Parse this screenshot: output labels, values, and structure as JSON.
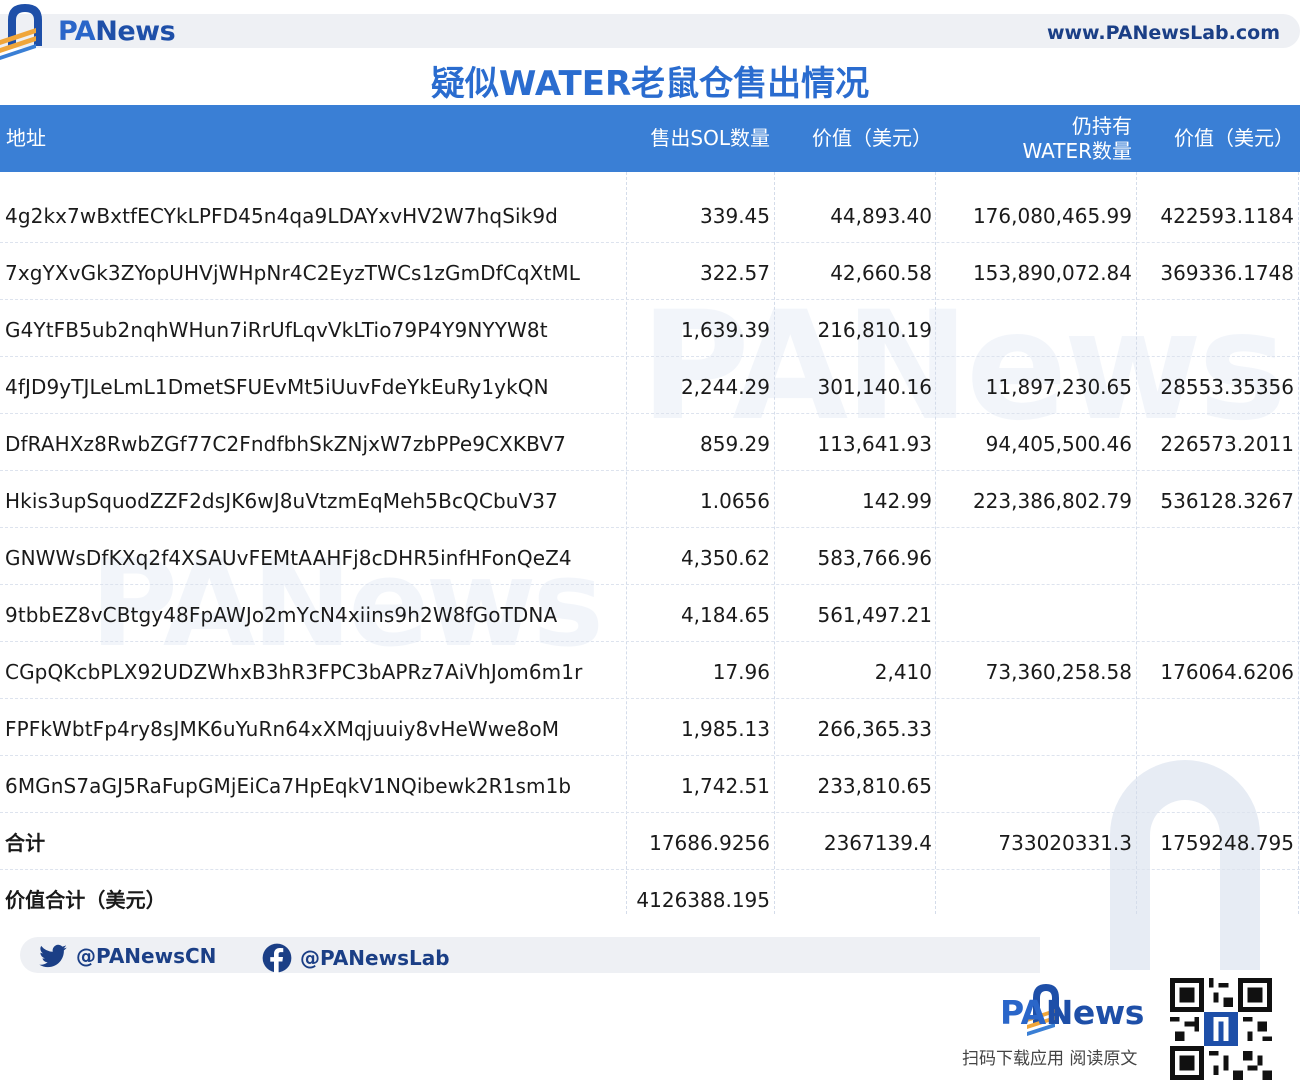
{
  "brand": {
    "logo_pa": "PA",
    "logo_news": "News",
    "url": "www.PANewsLab.com"
  },
  "title": "疑似WATER老鼠仓售出情况",
  "table": {
    "headers": {
      "address": "地址",
      "sol_sold": "售出SOL数量",
      "usd_value": "价值（美元）",
      "water_held_1": "仍持有",
      "water_held_2": "WATER数量",
      "water_value": "价值（美元）"
    },
    "rows": [
      {
        "address": "4g2kx7wBxtfECYkLPFD45n4qa9LDAYxvHV2W7hqSik9d",
        "sol": "339.45",
        "usd": "44,893.40",
        "water": "176,080,465.99",
        "value": "422593.1184"
      },
      {
        "address": "7xgYXvGk3ZYopUHVjWHpNr4C2EyzTWCs1zGmDfCqXtML",
        "sol": "322.57",
        "usd": "42,660.58",
        "water": "153,890,072.84",
        "value": "369336.1748"
      },
      {
        "address": "G4YtFB5ub2nqhWHun7iRrUfLqvVkLTio79P4Y9NYYW8t",
        "sol": "1,639.39",
        "usd": "216,810.19",
        "water": "",
        "value": ""
      },
      {
        "address": "4fJD9yTJLeLmL1DmetSFUEvMt5iUuvFdeYkEuRy1ykQN",
        "sol": "2,244.29",
        "usd": "301,140.16",
        "water": "11,897,230.65",
        "value": "28553.35356"
      },
      {
        "address": "DfRAHXz8RwbZGf77C2FndfbhSkZNjxW7zbPPe9CXKBV7",
        "sol": "859.29",
        "usd": "113,641.93",
        "water": "94,405,500.46",
        "value": "226573.2011"
      },
      {
        "address": "Hkis3upSquodZZF2dsJK6wJ8uVtzmEqMeh5BcQCbuV37",
        "sol": "1.0656",
        "usd": "142.99",
        "water": "223,386,802.79",
        "value": "536128.3267"
      },
      {
        "address": "GNWWsDfKXq2f4XSAUvFEMtAAHFj8cDHR5infHFonQeZ4",
        "sol": "4,350.62",
        "usd": "583,766.96",
        "water": "",
        "value": ""
      },
      {
        "address": "9tbbEZ8vCBtgy48FpAWJo2mYcN4xiins9h2W8fGoTDNA",
        "sol": "4,184.65",
        "usd": "561,497.21",
        "water": "",
        "value": ""
      },
      {
        "address": "CGpQKcbPLX92UDZWhxB3hR3FPC3bAPRz7AiVhJom6m1r",
        "sol": "17.96",
        "usd": "2,410",
        "water": "73,360,258.58",
        "value": "176064.6206"
      },
      {
        "address": "FPFkWbtFp4ry8sJMK6uYuRn64xXMqjuuiy8vHeWwe8oM",
        "sol": "1,985.13",
        "usd": "266,365.33",
        "water": "",
        "value": ""
      },
      {
        "address": "6MGnS7aGJ5RaFupGMjEiCa7HpEqkV1NQibewk2R1sm1b",
        "sol": "1,742.51",
        "usd": "233,810.65",
        "water": "",
        "value": ""
      }
    ],
    "total": {
      "label": "合计",
      "sol": "17686.9256",
      "usd": "2367139.4",
      "water": "733020331.3",
      "value": "1759248.795"
    },
    "grand_total": {
      "label": "价值合计（美元）",
      "value": "4126388.195"
    }
  },
  "footer": {
    "twitter": "@PANewsCN",
    "facebook": "@PANewsLab",
    "slogan": "扫码下载应用  阅读原文"
  },
  "icons": [
    "panews-logo-icon",
    "twitter-icon",
    "facebook-icon",
    "qr-code-icon"
  ],
  "colors": {
    "header_bg": "#3a7fd5",
    "title": "#2a6ccf",
    "brand": "#1e4fa8",
    "accent_orange": "#f0a63a"
  }
}
